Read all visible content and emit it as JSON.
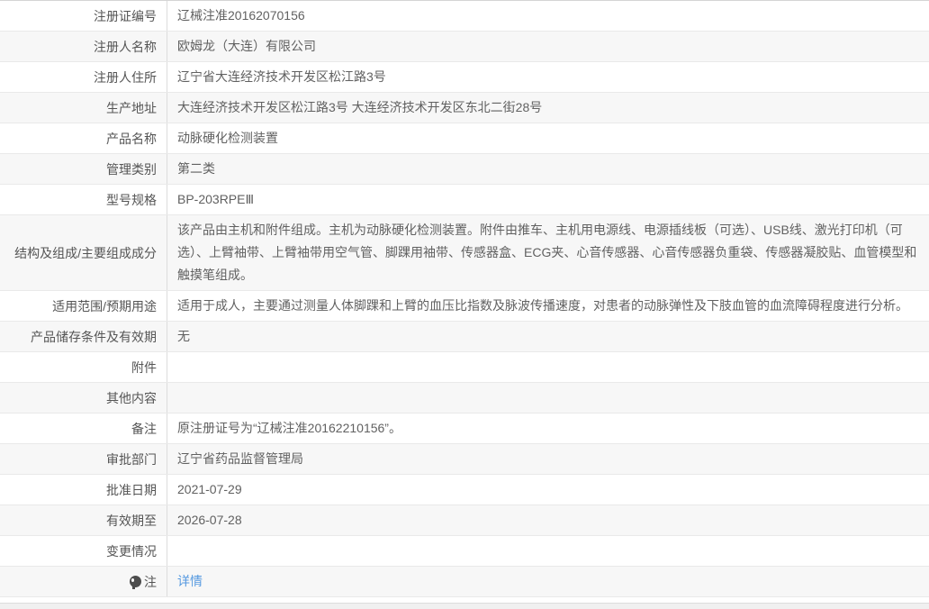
{
  "page": {
    "link_color": "#5599e0",
    "stripe_color": "#f7f7f7",
    "footer_bar_color": "#f0f0f0"
  },
  "table": {
    "rows": [
      {
        "label": "注册证编号",
        "value": "辽械注准20162070156"
      },
      {
        "label": "注册人名称",
        "value": "欧姆龙（大连）有限公司"
      },
      {
        "label": "注册人住所",
        "value": "辽宁省大连经济技术开发区松江路3号"
      },
      {
        "label": "生产地址",
        "value": "大连经济技术开发区松江路3号 大连经济技术开发区东北二街28号"
      },
      {
        "label": "产品名称",
        "value": "动脉硬化检测装置"
      },
      {
        "label": "管理类别",
        "value": "第二类"
      },
      {
        "label": "型号规格",
        "value": "BP-203RPEⅢ"
      },
      {
        "label": "结构及组成/主要组成成分",
        "value": "该产品由主机和附件组成。主机为动脉硬化检测装置。附件由推车、主机用电源线、电源插线板（可选）、USB线、激光打印机（可选）、上臂袖带、上臂袖带用空气管、脚踝用袖带、传感器盒、ECG夹、心音传感器、心音传感器负重袋、传感器凝胶贴、血管模型和触摸笔组成。"
      },
      {
        "label": "适用范围/预期用途",
        "value": "适用于成人，主要通过测量人体脚踝和上臂的血压比指数及脉波传播速度，对患者的动脉弹性及下肢血管的血流障碍程度进行分析。"
      },
      {
        "label": "产品储存条件及有效期",
        "value": "无"
      },
      {
        "label": "附件",
        "value": ""
      },
      {
        "label": "其他内容",
        "value": ""
      },
      {
        "label": "备注",
        "value": "原注册证号为“辽械注准20162210156”。"
      },
      {
        "label": "审批部门",
        "value": "辽宁省药品监督管理局"
      },
      {
        "label": "批准日期",
        "value": "2021-07-29"
      },
      {
        "label": "有效期至",
        "value": "2026-07-28"
      },
      {
        "label": "变更情况",
        "value": ""
      },
      {
        "label": "注",
        "icon": "balloon-icon",
        "link_label": "详情"
      }
    ]
  }
}
